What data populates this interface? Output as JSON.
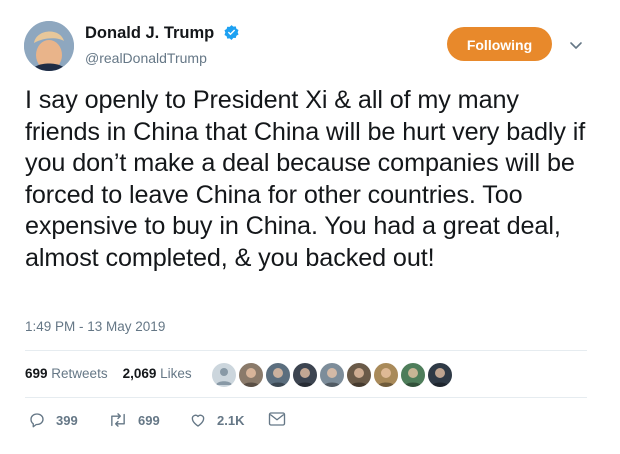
{
  "author": {
    "name": "Donald J. Trump",
    "handle": "@realDonaldTrump",
    "verified": true
  },
  "follow_button": {
    "label": "Following",
    "color": "#e8892b"
  },
  "tweet": {
    "text": "I say openly to President Xi & all of my many friends in China that China will be hurt very badly if you don’t make a deal because companies will be forced to leave China for other countries. Too expensive to buy in China. You had a great deal, almost completed, & you backed out!",
    "timestamp": "1:49 PM - 13 May 2019"
  },
  "stats": {
    "retweets_count": "699",
    "retweets_label": "Retweets",
    "likes_count": "2,069",
    "likes_label": "Likes"
  },
  "liker_avatars": [
    {
      "name": "default-avatar",
      "color": "#ccd6dd"
    },
    {
      "name": "liker-avatar-1",
      "color": "#8a7a6a"
    },
    {
      "name": "liker-avatar-2",
      "color": "#5b6e7e"
    },
    {
      "name": "liker-avatar-3",
      "color": "#3c4450"
    },
    {
      "name": "liker-avatar-4",
      "color": "#7d8d9a"
    },
    {
      "name": "liker-avatar-5",
      "color": "#6a5a48"
    },
    {
      "name": "liker-avatar-6",
      "color": "#a98a5a"
    },
    {
      "name": "liker-avatar-7",
      "color": "#4e7d5a"
    },
    {
      "name": "liker-avatar-8",
      "color": "#2f3a46"
    }
  ],
  "actions": {
    "reply_count": "399",
    "retweet_count": "699",
    "like_count": "2.1K"
  },
  "colors": {
    "text": "#14171a",
    "secondary": "#657786",
    "verified": "#1da1f2",
    "divider": "#e6ecf0"
  }
}
